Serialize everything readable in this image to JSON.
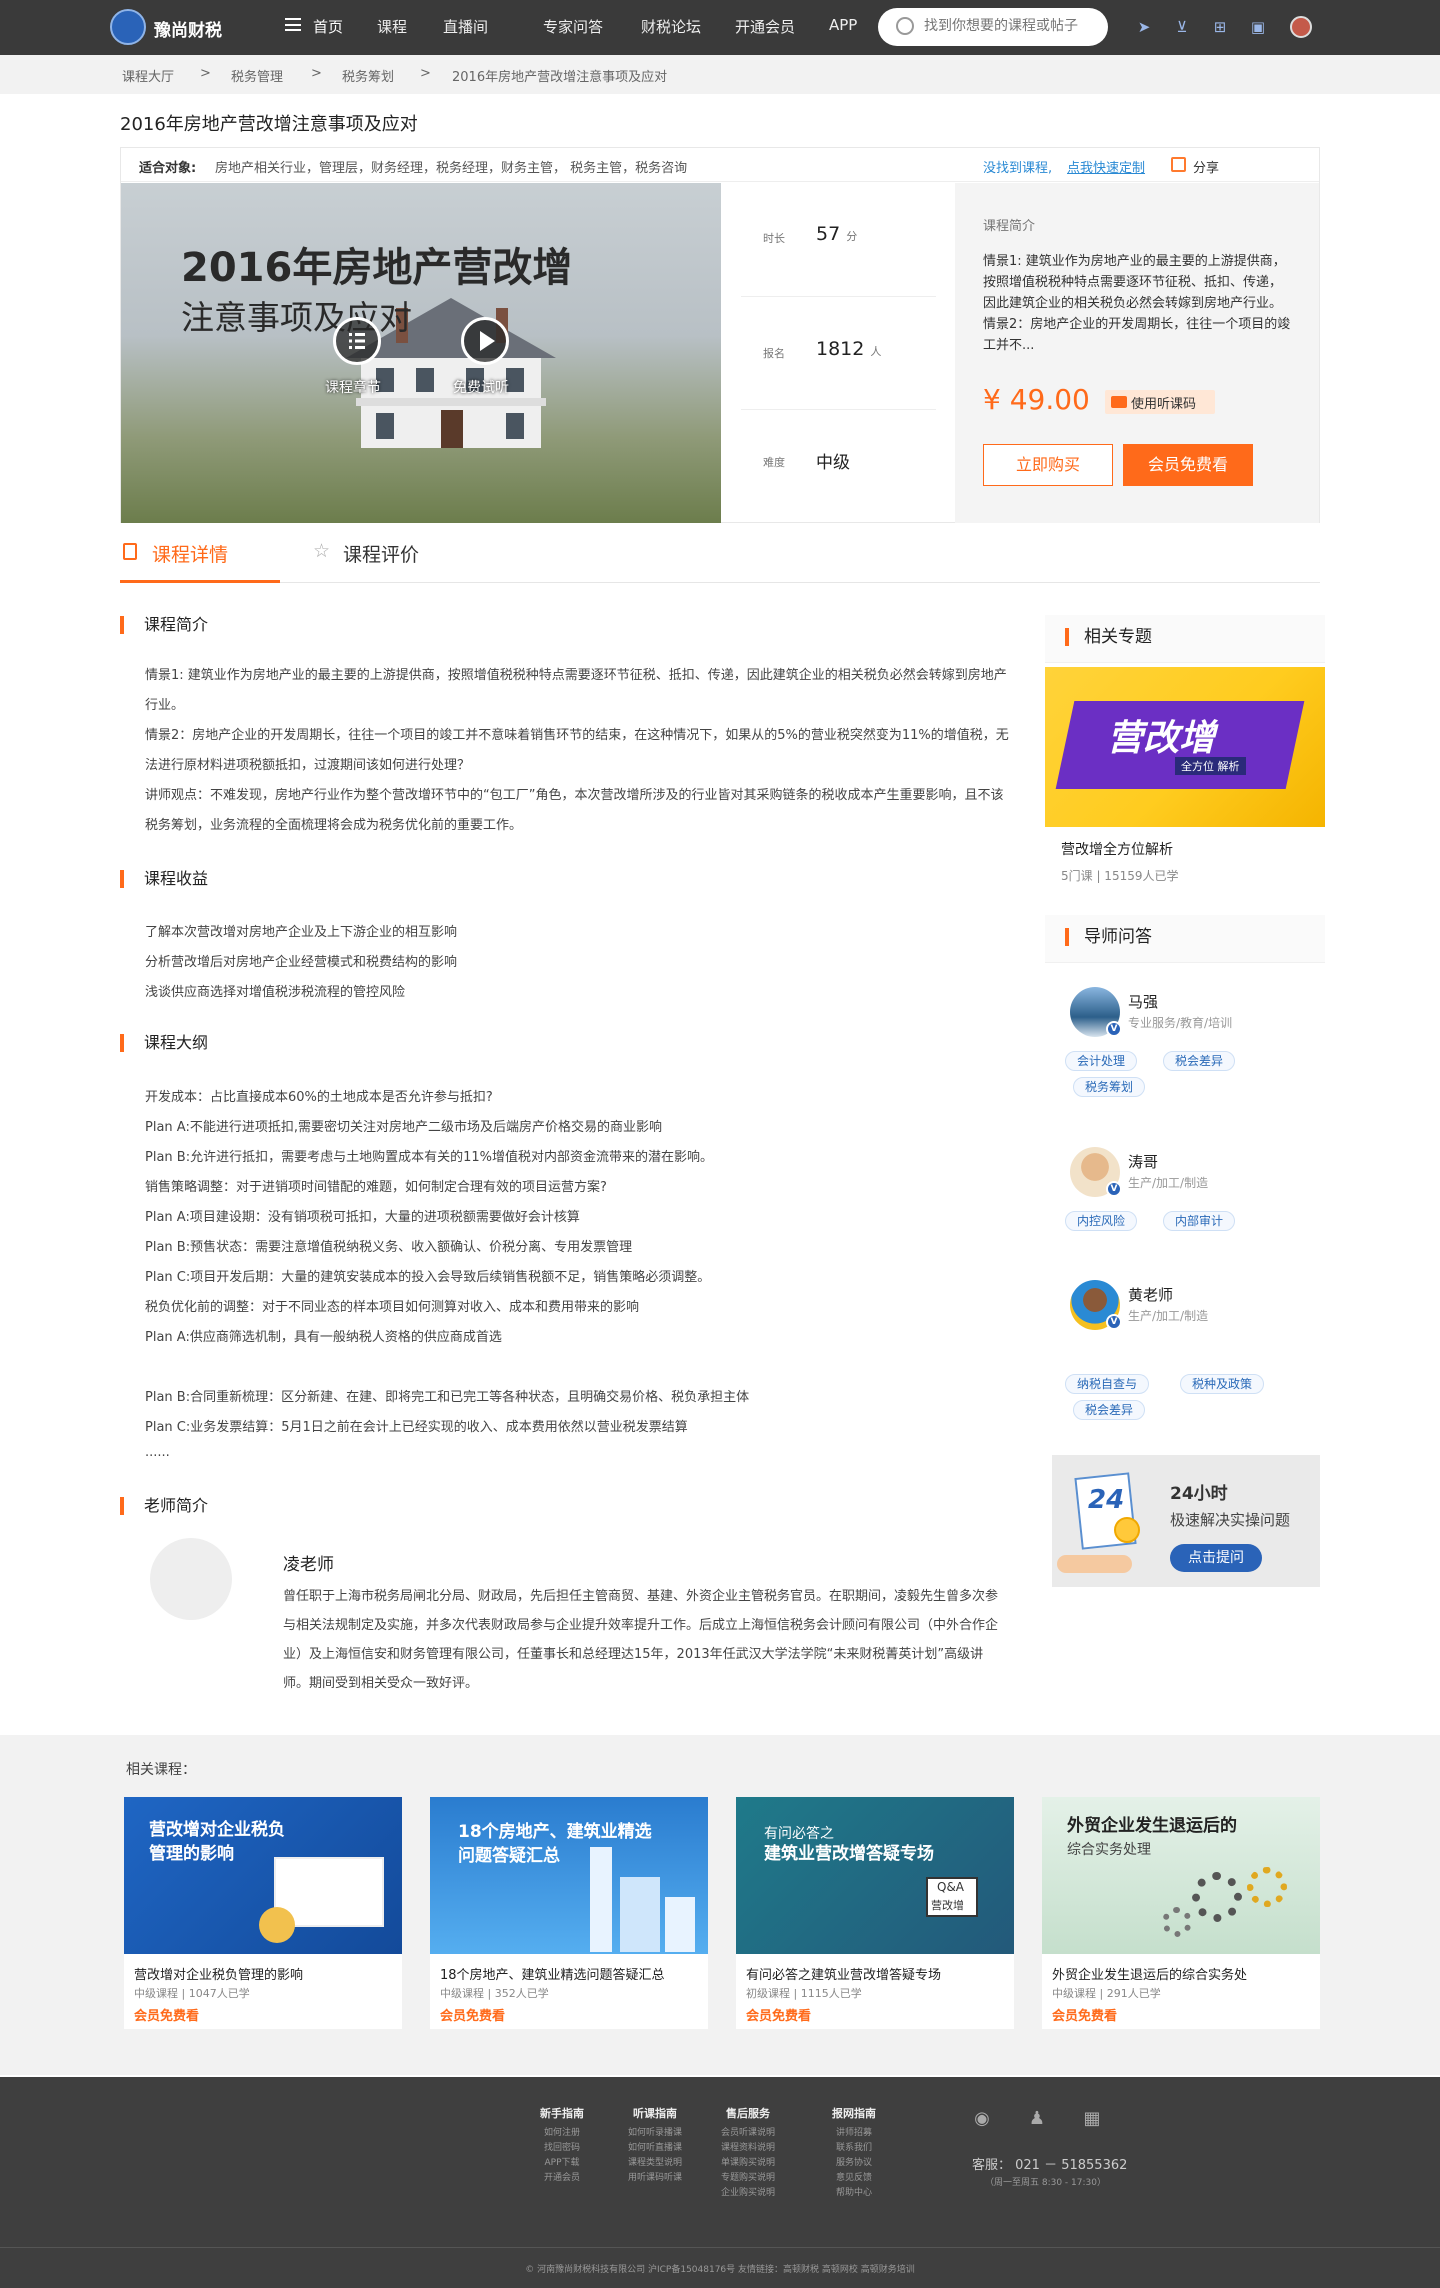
{
  "header": {
    "logo_text": "豫尚财税",
    "nav": [
      "首页",
      "课程",
      "直播间",
      "专家问答",
      "财税论坛",
      "开通会员",
      "APP"
    ],
    "search_placeholder": "找到你想要的课程或帖子"
  },
  "breadcrumb": [
    "课程大厅",
    ">",
    "税务管理",
    ">",
    "税务筹划",
    ">",
    "2016年房地产营改增注意事项及应对"
  ],
  "course": {
    "title": "2016年房地产营改增注意事项及应对",
    "audience_label": "适合对象:",
    "audience": "房地产相关行业，管理层，财务经理，税务经理，财务主管， 税务主管，税务咨询",
    "custom_prefix": "没找到课程,",
    "custom_link": "点我快速定制",
    "share": "分享",
    "cover_title1": "2016年房地产营改增",
    "cover_title2": "注意事项及应对",
    "chapters_label": "课程章节",
    "trial_label": "免费试听",
    "stats": [
      {
        "label": "时长",
        "value": "57",
        "unit": "分"
      },
      {
        "label": "报名",
        "value": "1812",
        "unit": "人"
      },
      {
        "label": "难度",
        "value": "中级",
        "unit": ""
      }
    ],
    "intro_heading": "课程简介",
    "intro_text": "情景1: 建筑业作为房地产业的最主要的上游提供商，按照增值税税种特点需要逐环节征税、抵扣、传递，因此建筑企业的相关税负必然会转嫁到房地产行业。情景2：房地产企业的开发周期长，往往一个项目的竣工并不...",
    "price": "¥ 49.00",
    "listen": "使用听课码",
    "buy": "立即购买",
    "member_free": "会员免费看"
  },
  "tabs": {
    "detail": "课程详情",
    "review": "课程评价"
  },
  "sections": {
    "intro_h": "课程简介",
    "intro_paras": [
      "情景1: 建筑业作为房地产业的最主要的上游提供商，按照增值税税种特点需要逐环节征税、抵扣、传递，因此建筑企业的相关税负必然会转嫁到房地产行业。",
      "情景2：房地产企业的开发周期长，往往一个项目的竣工并不意味着销售环节的结束，在这种情况下，如果从的5%的营业税突然变为11%的增值税，无法进行原材料进项税额抵扣，过渡期间该如何进行处理？",
      "讲师观点：不难发现，房地产行业作为整个营改增环节中的“包工厂”角色，本次营改增所涉及的行业皆对其采购链条的税收成本产生重要影响，且不该税务筹划，业务流程的全面梳理将会成为税务优化前的重要工作。"
    ],
    "gain_h": "课程收益",
    "gains": [
      "了解本次营改增对房地产企业及上下游企业的相互影响",
      "分析营改增后对房地产企业经营模式和税费结构的影响",
      "浅谈供应商选择对增值税涉税流程的管控风险"
    ],
    "outline_h": "课程大纲",
    "outline": [
      "开发成本：占比直接成本60%的土地成本是否允许参与抵扣?",
      "Plan  A:不能进行进项抵扣,需要密切关注对房地产二级市场及后端房产价格交易的商业影响",
      "Plan  B:允许进行抵扣，需要考虑与土地购置成本有关的11%增值税对内部资金流带来的潜在影响。",
      "销售策略调整：对于进销项时间错配的难题，如何制定合理有效的项目运营方案?",
      "Plan  A:项目建设期：没有销项税可抵扣，大量的进项税额需要做好会计核算",
      "Plan  B:预售状态：需要注意增值税纳税义务、收入额确认、价税分离、专用发票管理",
      "Plan  C:项目开发后期：大量的建筑安装成本的投入会导致后续销售税额不足，销售策略必须调整。",
      "税负优化前的调整：对于不同业态的样本项目如何测算对收入、成本和费用带来的影响",
      "Plan  A:供应商筛选机制，具有一般纳税人资格的供应商成首选",
      "Plan  B:合同重新梳理：区分新建、在建、即将完工和已完工等各种状态，且明确交易价格、税负承担主体",
      "Plan  C:业务发票结算：5月1日之前在会计上已经实现的收入、成本费用依然以营业税发票结算",
      "......"
    ],
    "teacher_h": "老师简介",
    "teacher_name": "凌老师",
    "teacher_bio": "曾任职于上海市税务局闸北分局、财政局，先后担任主管商贸、基建、外资企业主管税务官员。在职期间，凌毅先生曾多次参与相关法规制定及实施，并多次代表财政局参与企业提升效率提升工作。后成立上海恒信税务会计顾问有限公司（中外合作企业）及上海恒信安和财务管理有限公司，任董事长和总经理达15年，2013年任武汉大学法学院“未来财税菁英计划”高级讲师。期间受到相关受众一致好评。"
  },
  "sidebar": {
    "topic_h": "相关专题",
    "topic_word": "营改增",
    "topic_sub": "全方位 解析",
    "topic_name": "营改增全方位解析",
    "topic_meta": "5门课  |  15159人已学",
    "tutor_h": "导师问答",
    "tutors": [
      {
        "name": "马强",
        "field": "专业服务/教育/培训",
        "tags": [
          "会计处理",
          "税会差异",
          "税务筹划"
        ]
      },
      {
        "name": "涛哥",
        "field": "生产/加工/制造",
        "tags": [
          "内控风险",
          "内部审计"
        ]
      },
      {
        "name": "黄老师",
        "field": "生产/加工/制造",
        "tags": [
          "纳税自查与",
          "税种及政策",
          "税会差异"
        ]
      }
    ],
    "promo_cal": "24",
    "promo_t1": "24小时",
    "promo_t2": "极速解决实操问题",
    "promo_btn": "点击提问"
  },
  "related": {
    "title": "相关课程：",
    "cards": [
      {
        "img_text": "营改增对企业税负管理的影响",
        "title": "营改增对企业税负管理的影响",
        "level": "中级课程",
        "learners": "1047人已学",
        "free": "会员免费看",
        "color": "#1d5fbf"
      },
      {
        "img_text": "18个房地产、建筑业精选问题答疑汇总",
        "title": "18个房地产、建筑业精选问题答疑汇总",
        "level": "中级课程",
        "learners": "352人已学",
        "free": "会员免费看",
        "color": "#2f86d6"
      },
      {
        "img_text": "有问必答之建筑业营改增答疑专场",
        "title": "有问必答之建筑业营改增答疑专场",
        "level": "初级课程",
        "learners": "1115人已学",
        "free": "会员免费看",
        "color": "#1e7e8c"
      },
      {
        "img_text": "外贸企业发生退运后的综合实务处理",
        "title": "外贸企业发生退运后的综合实务处",
        "level": "中级课程",
        "learners": "291人已学",
        "free": "会员免费看",
        "color": "#cfe7d6"
      }
    ],
    "card_img_lines": [
      [
        "营改增对企业税负",
        "管理的影响"
      ],
      [
        "18个房地产、建筑业精选",
        "问题答疑汇总"
      ],
      [
        "有问必答之",
        "建筑业营改增答疑专场"
      ],
      [
        "外贸企业发生退运后的",
        "综合实务处理"
      ]
    ],
    "card3_qa": "Q&A",
    "card3_sign": "营改增"
  },
  "footer": {
    "cols": [
      {
        "h": "新手指南",
        "items": [
          "如何注册",
          "找回密码",
          "APP下载",
          "开通会员"
        ]
      },
      {
        "h": "听课指南",
        "items": [
          "如何听录播课",
          "如何听直播课",
          "课程类型说明",
          "用听课码听课"
        ]
      },
      {
        "h": "售后服务",
        "items": [
          "会员听课说明",
          "课程资料说明",
          "单课购买说明",
          "专题购买说明",
          "企业购买说明"
        ]
      },
      {
        "h": "报网指南",
        "items": [
          "讲师招募",
          "联系我们",
          "服务协议",
          "意见反馈",
          "帮助中心"
        ]
      }
    ],
    "phone": "客服：  021 － 51855362",
    "hours": "（周一至周五  8:30 - 17:30）",
    "legal": "© 河南豫尚财税科技有限公司        沪ICP备15048176号        友情链接：高顿财税   高顿网校   高顿财务培训"
  }
}
